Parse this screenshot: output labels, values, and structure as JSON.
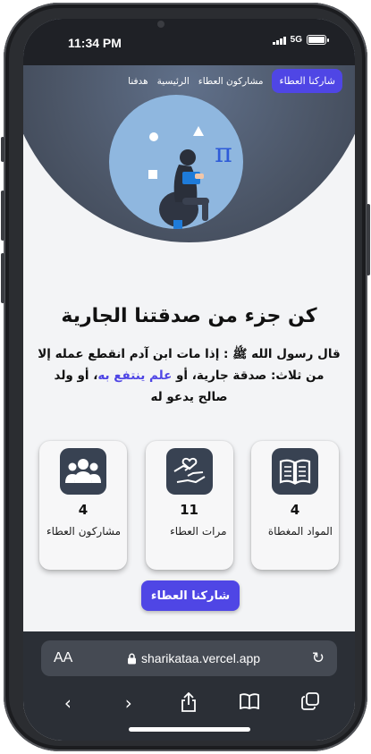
{
  "status_bar": {
    "time": "11:34 PM",
    "network": "5G"
  },
  "nav": {
    "cta_label": "شاركنا العطاء",
    "items": [
      "مشاركون العطاء",
      "الرئيسية",
      "هدفنا"
    ]
  },
  "hero": {
    "pi_symbol": "π"
  },
  "main": {
    "title": "كن جزء من صدقتنا الجارية",
    "hadith_part1": "قال رسول الله ﷺ : إذا مات ابن آدم انقطع عمله إلا من ثلاث: صدقة جارية، أو ",
    "hadith_highlight": "علم ينتفع به",
    "hadith_part2": "، أو ولد صالح يدعو له"
  },
  "stats": [
    {
      "icon": "book-icon",
      "value": "4",
      "label": "المواد المغطاة"
    },
    {
      "icon": "hands-heart-icon",
      "value": "11",
      "label": "مرات العطاء"
    },
    {
      "icon": "users-icon",
      "value": "4",
      "label": "مشاركون العطاء"
    }
  ],
  "share_button": "شاركنا العطاء",
  "browser": {
    "aa_label": "AA",
    "url": "sharikataa.vercel.app"
  },
  "colors": {
    "accent": "#4f46e5",
    "icon_tile": "#384252",
    "hero": "#4b5566"
  }
}
